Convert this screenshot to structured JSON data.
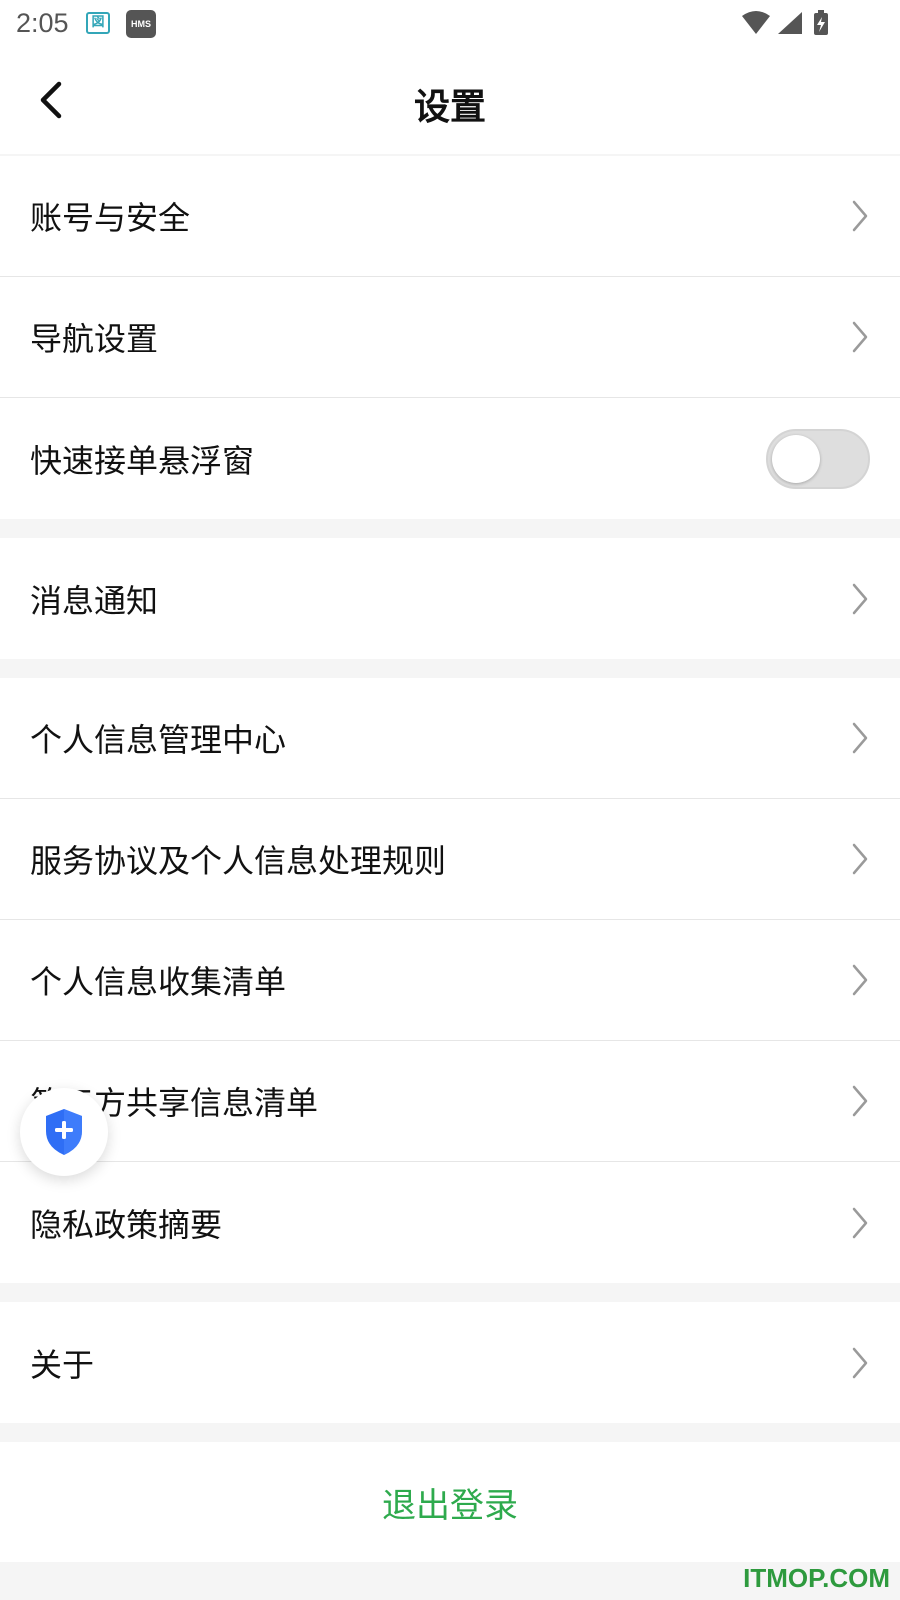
{
  "status_bar": {
    "time": "2:05",
    "app_icon_glyph": "図",
    "hms_label": "HMS",
    "icons": [
      "wifi-icon",
      "signal-icon",
      "battery-icon"
    ]
  },
  "header": {
    "title": "设置",
    "back_icon": "chevron-left-icon"
  },
  "groups": [
    {
      "items": [
        {
          "label": "账号与安全",
          "type": "link"
        },
        {
          "label": "导航设置",
          "type": "link"
        },
        {
          "label": "快速接单悬浮窗",
          "type": "toggle",
          "value": false
        }
      ]
    },
    {
      "items": [
        {
          "label": "消息通知",
          "type": "link"
        }
      ]
    },
    {
      "items": [
        {
          "label": "个人信息管理中心",
          "type": "link"
        },
        {
          "label": "服务协议及个人信息处理规则",
          "type": "link"
        },
        {
          "label": "个人信息收集清单",
          "type": "link"
        },
        {
          "label": "第三方共享信息清单",
          "type": "link"
        },
        {
          "label": "隐私政策摘要",
          "type": "link"
        }
      ]
    },
    {
      "items": [
        {
          "label": "关于",
          "type": "link"
        }
      ]
    }
  ],
  "logout": {
    "label": "退出登录"
  },
  "floating_button": {
    "icon": "shield-plus-icon"
  },
  "watermark": "ITMOP.COM",
  "colors": {
    "accent_green": "#2eaa4d",
    "background": "#f5f5f5",
    "shield_blue": "#2f6ef5"
  }
}
